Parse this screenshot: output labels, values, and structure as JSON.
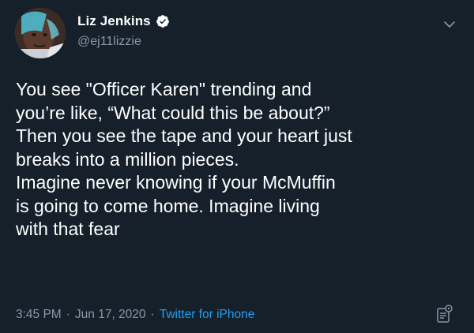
{
  "author": {
    "name": "Liz Jenkins",
    "handle": "@ej11lizzie",
    "verified": true
  },
  "tweet": {
    "lines": [
      "You see \"Officer Karen\" trending and",
      "you’re like, “What could this be about?”",
      "Then you see the tape and your heart just",
      "breaks into a million pieces.",
      "Imagine never knowing if your McMuffin",
      "is going to come home. Imagine living",
      "with that fear"
    ],
    "time": "3:45 PM",
    "separator": "·",
    "date": "Jun 17, 2020",
    "source": "Twitter for iPhone"
  },
  "icons": {
    "verified": "verified-badge-icon",
    "menu": "chevron-down-icon",
    "analytics": "analytics-icon"
  },
  "colors": {
    "background": "#15202b",
    "text": "#ffffff",
    "secondary": "#8899a6",
    "accent": "#1da1f2"
  }
}
